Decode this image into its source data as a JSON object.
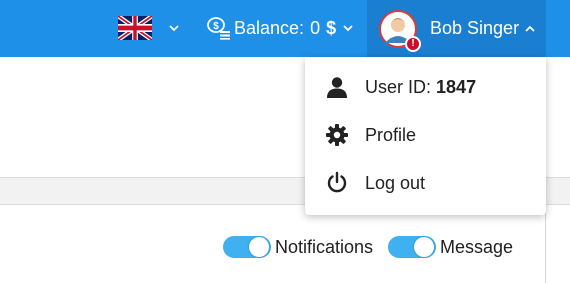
{
  "colors": {
    "topbar": "#1e90e8",
    "user_menu_active": "#1a7fd1",
    "toggle_on": "#3fb0f0",
    "alert_badge": "#c8102e"
  },
  "header": {
    "language": {
      "icon": "uk-flag-icon",
      "dropdown_icon": "chevron-down-icon"
    },
    "balance": {
      "icon": "coins-icon",
      "label": "Balance:",
      "amount": "0",
      "currency": "$",
      "dropdown_icon": "chevron-down-icon"
    },
    "user": {
      "avatar_icon": "user-avatar-icon",
      "alert_icon": "exclamation-icon",
      "alert_glyph": "!",
      "name": "Bob Singer",
      "dropdown_icon": "chevron-up-icon"
    }
  },
  "user_menu": {
    "user_id_prefix": "User ID:",
    "user_id_value": "1847",
    "items": [
      {
        "icon": "person-icon",
        "label": "User ID:"
      },
      {
        "icon": "gear-icon",
        "label": "Profile"
      },
      {
        "icon": "power-icon",
        "label": "Log out"
      }
    ]
  },
  "toggles": [
    {
      "label": "Notifications",
      "on": true
    },
    {
      "label": "Message",
      "on": true
    }
  ]
}
